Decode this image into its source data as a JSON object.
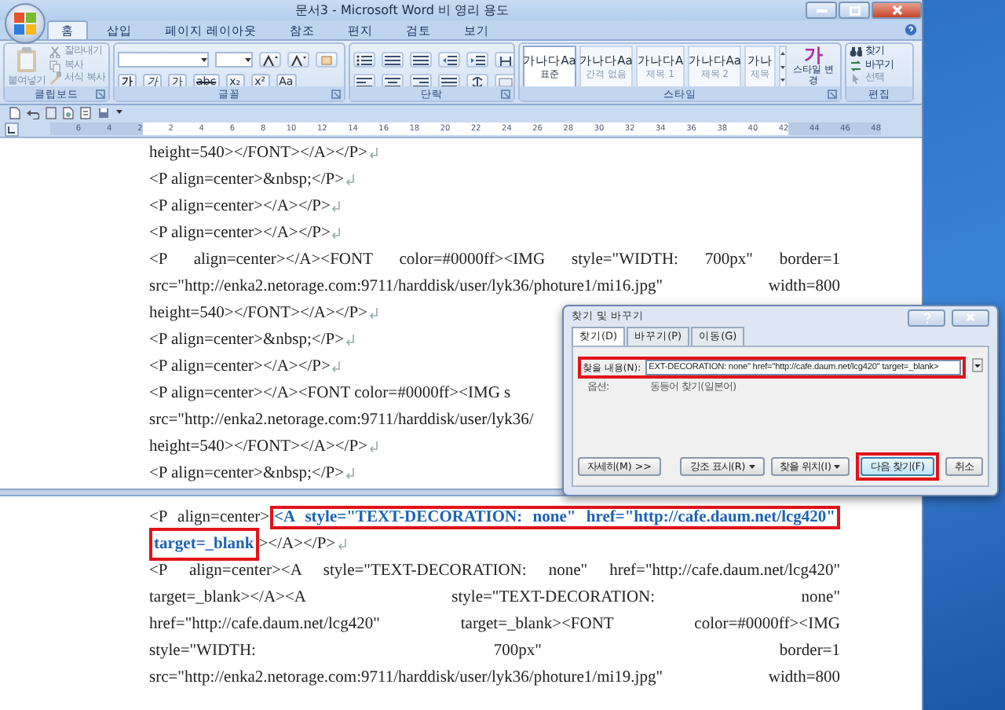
{
  "window": {
    "title": "문서3 - Microsoft Word 비 영리 용도"
  },
  "ribbon_tabs": [
    {
      "label": "홈",
      "selected": true
    },
    {
      "label": "삽입",
      "selected": false
    },
    {
      "label": "페이지 레이아웃",
      "selected": false
    },
    {
      "label": "참조",
      "selected": false
    },
    {
      "label": "편지",
      "selected": false
    },
    {
      "label": "검토",
      "selected": false
    },
    {
      "label": "보기",
      "selected": false
    }
  ],
  "ribbon_groups": [
    {
      "kind": "clipboard",
      "label": "클립보드",
      "paste": {
        "label": "붙여넣기",
        "disabled": true
      },
      "items": [
        {
          "label": "잘라내기",
          "disabled": true
        },
        {
          "label": "복사",
          "disabled": true
        },
        {
          "label": "서식 복사",
          "disabled": true
        }
      ]
    },
    {
      "kind": "font",
      "label": "글꼴",
      "format_buttons": [
        {
          "kind": "bold",
          "glyph": "가"
        },
        {
          "kind": "italic",
          "glyph": "가"
        },
        {
          "kind": "underline",
          "glyph": "가"
        },
        {
          "kind": "strike",
          "glyph": "abc"
        },
        {
          "kind": "subscript",
          "glyph": "x₂"
        },
        {
          "kind": "superscript",
          "glyph": "x²"
        },
        {
          "kind": "case",
          "glyph": "Aa"
        }
      ]
    },
    {
      "kind": "paragraph",
      "label": "단락"
    },
    {
      "kind": "styles",
      "label": "스타일",
      "styles": [
        {
          "sample": "가나다Aa",
          "name": "표준",
          "selected": true
        },
        {
          "sample": "가나다Aa",
          "name": "간격 없음",
          "selected": false
        },
        {
          "sample": "가나다A",
          "name": "제목 1",
          "selected": false
        },
        {
          "sample": "가나다Aa",
          "name": "제목 2",
          "selected": false
        },
        {
          "sample": "가나",
          "name": "제목",
          "selected": false
        }
      ],
      "change_button": {
        "glyph": "가",
        "label": "스타일 변경"
      }
    },
    {
      "kind": "editing",
      "label": "편집",
      "items": [
        {
          "label": "찾기",
          "disabled": false
        },
        {
          "label": "바꾸기",
          "disabled": false
        },
        {
          "label": "선택",
          "disabled": true
        }
      ]
    }
  ],
  "ruler": {
    "left_numbers": [
      "6",
      "4",
      "2"
    ],
    "numbers": [
      "2",
      "4",
      "6",
      "8",
      "10",
      "12",
      "14",
      "16",
      "18",
      "20",
      "22",
      "24",
      "26",
      "28",
      "30",
      "32",
      "34",
      "36",
      "38",
      "40",
      "42"
    ],
    "right_numbers": [
      "44",
      "46",
      "48"
    ]
  },
  "document": {
    "top_pane": [
      {
        "text": "height=540></FONT></A></P>",
        "justified": false,
        "paragraph_end": true
      },
      {
        "text": "<P align=center>&nbsp;</P>",
        "justified": false,
        "paragraph_end": true
      },
      {
        "text": "<P align=center></A></P>",
        "justified": false,
        "paragraph_end": true
      },
      {
        "text": "<P align=center></A></P>",
        "justified": false,
        "paragraph_end": true
      },
      {
        "text": "<P align=center></A><FONT color=#0000ff><IMG style=\"WIDTH: 700px\" border=1",
        "justified": true,
        "paragraph_end": false
      },
      {
        "text": "src=\"http://enka2.netorage.com:9711/harddisk/user/lyk36/photure1/mi16.jpg\" width=800",
        "justified": true,
        "paragraph_end": false
      },
      {
        "text": "height=540></FONT></A></P>",
        "justified": false,
        "paragraph_end": true
      },
      {
        "text": "<P align=center>&nbsp;</P>",
        "justified": false,
        "paragraph_end": true
      },
      {
        "text": "<P align=center></A></P>",
        "justified": false,
        "paragraph_end": true
      },
      {
        "text": "<P align=center></A><FONT color=#0000ff><IMG s",
        "justified": false,
        "paragraph_end": false
      },
      {
        "text": "src=\"http://enka2.netorage.com:9711/harddisk/user/lyk36/",
        "justified": false,
        "paragraph_end": false
      },
      {
        "text": "height=540></FONT></A></P>",
        "justified": false,
        "paragraph_end": true
      },
      {
        "text": "<P align=center>&nbsp;</P>",
        "justified": false,
        "paragraph_end": true
      }
    ],
    "bottom_pane": [
      {
        "parts": [
          {
            "text": "<P align=center>",
            "found": false
          },
          {
            "text": "<A style=\"TEXT-DECORATION: none\" href=\"http://cafe.daum.net/lcg420\"",
            "found": true
          }
        ],
        "justified": true,
        "paragraph_end": false
      },
      {
        "parts": [
          {
            "text": "target=_blank",
            "found": true
          },
          {
            "text": "></A></P>",
            "found": false
          }
        ],
        "justified": false,
        "paragraph_end": true
      },
      {
        "text": "<P align=center><A style=\"TEXT-DECORATION: none\" href=\"http://cafe.daum.net/lcg420\"",
        "justified": true,
        "paragraph_end": false
      },
      {
        "text": "target=_blank></A><A style=\"TEXT-DECORATION: none\"",
        "justified": true,
        "paragraph_end": false
      },
      {
        "text": "href=\"http://cafe.daum.net/lcg420\" target=_blank><FONT color=#0000ff><IMG",
        "justified": true,
        "paragraph_end": false
      },
      {
        "text": "style=\"WIDTH: 700px\" border=1",
        "justified": true,
        "paragraph_end": false
      },
      {
        "text": "src=\"http://enka2.netorage.com:9711/harddisk/user/lyk36/photure1/mi19.jpg\" width=800",
        "justified": true,
        "paragraph_end": false
      }
    ]
  },
  "find_dialog": {
    "title": "찾기 및 바꾸기",
    "tabs": [
      {
        "label": "찾기(D)",
        "selected": true
      },
      {
        "label": "바꾸기(P)",
        "selected": false
      },
      {
        "label": "이동(G)",
        "selected": false
      }
    ],
    "find_field": {
      "label": "찾을 내용(N):",
      "value": "EXT-DECORATION: none\" href=\"http://cafe.daum.net/lcg420\" target=_blank>",
      "annotated": true
    },
    "options": {
      "label": "옵션:",
      "value": "동등어 찾기(일본어)"
    },
    "buttons": [
      {
        "kind": "more",
        "label": "자세히(M) >>",
        "annotated": false
      },
      {
        "kind": "menu",
        "label": "강조 표시(R)",
        "annotated": false
      },
      {
        "kind": "menu",
        "label": "찾을 위치(I)",
        "annotated": false
      },
      {
        "kind": "default",
        "label": "다음 찾기(F)",
        "annotated": true
      },
      {
        "kind": "plain",
        "label": "취소",
        "annotated": false
      }
    ]
  }
}
